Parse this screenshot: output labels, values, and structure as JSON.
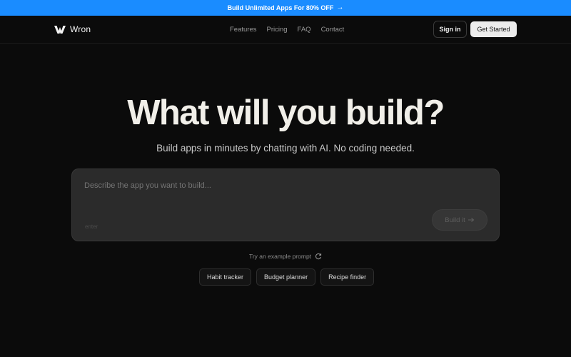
{
  "promo": {
    "text": "Build Unlimited Apps For 80% OFF",
    "arrow": "→"
  },
  "brand": {
    "name": "Wron",
    "icon": "wron-logo-icon"
  },
  "nav": {
    "links": [
      "Features",
      "Pricing",
      "FAQ",
      "Contact"
    ],
    "signin_label": "Sign in",
    "get_started_label": "Get Started"
  },
  "hero": {
    "title": "What will you build?",
    "subtitle": "Build apps in minutes by chatting with AI. No coding needed."
  },
  "prompt": {
    "placeholder": "Describe the app you want to build...",
    "value": "",
    "hint": "enter",
    "build_label": "Build it",
    "build_icon": "arrow-right-icon"
  },
  "examples": {
    "label": "Try an example prompt",
    "refresh_icon": "refresh-icon",
    "chips": [
      "Habit tracker",
      "Budget planner",
      "Recipe finder"
    ]
  },
  "colors": {
    "promo_bg": "#1a8cff",
    "page_bg": "#0b0b0b",
    "prompt_bg": "#2b2b2b",
    "cta_bg": "#ececec"
  }
}
